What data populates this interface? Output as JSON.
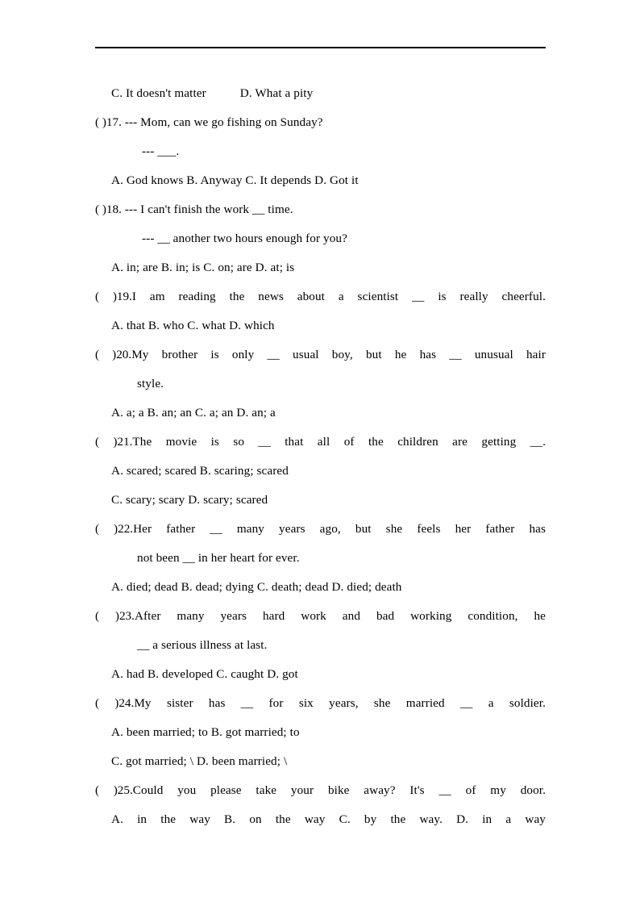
{
  "document": {
    "type": "english-grammar-multiple-choice-worksheet",
    "watermark_text": "",
    "lines": {
      "c_d_options_16": {
        "c": "C. It  doesn't  matter",
        "d": "D. What  a  pity"
      },
      "q17": {
        "marker": "(  )17.",
        "stem_line1": "---  Mom,  can  we  go  fishing  on  Sunday?",
        "stem_line2": "---  ___.",
        "options": "A. God  knows      B. Anyway      C. It  depends    D. Got  it"
      },
      "q18": {
        "marker": "(  )18.",
        "stem_line1": "---  I  can't  finish  the  work  __  time.",
        "stem_line2": "---  __  another  two  hours  enough  for  you?",
        "options": "A. in;  are      B. in;  is      C. on;  are      D. at;  is"
      },
      "q19": {
        "marker": "(  )19.",
        "stem": "I  am  reading  the  news  about  a  scientist  __  is  really  cheerful.",
        "options": "A. that            B. who          C. what          D. which"
      },
      "q20": {
        "marker": "(  )20.",
        "stem_line1": "My  brother  is  only  __  usual  boy,  but  he  has  __  unusual  hair",
        "stem_line2": "style.",
        "options": "A. a;  a            B. an;  an      C. a;  an        D. an;  a"
      },
      "q21": {
        "marker": "(  )21.",
        "stem": "The  movie  is  so  __  that  all  of  the  children  are  getting  __.",
        "options_line1": "A. scared; scared        B. scaring; scared",
        "options_line2": "C. scary; scary          D. scary; scared"
      },
      "q22": {
        "marker": "(  )22.",
        "stem_line1": "Her  father  __  many  years  ago,  but  she  feels  her  father  has",
        "stem_line2": "not  been  __  in  her  heart  for  ever.",
        "options": "A. died; dead    B. dead; dying    C. death; dead      D. died;  death"
      },
      "q23": {
        "marker": "(  )23.",
        "stem_line1": "After  many  years  hard  work  and  bad  working  condition,  he",
        "stem_line2": "__  a  serious  illness  at  last.",
        "options": "A.  had        B. developed        C. caught      D. got"
      },
      "q24": {
        "marker": "(  )24.",
        "stem": "My  sister  has   __   for  six  years,  she  married  __  a  soldier.",
        "options_line1": "A. been  married;  to        B. got  married;  to",
        "options_line2": "C. got  married;  \\          D. been  married;  \\"
      },
      "q25": {
        "marker": "(  )25.",
        "stem": "Could  you  please  take  your  bike  away?  It's  __  of  my  door.",
        "options": "A. in  the  way    B. on  the  way    C. by  the  way.    D. in  a  way"
      }
    }
  }
}
